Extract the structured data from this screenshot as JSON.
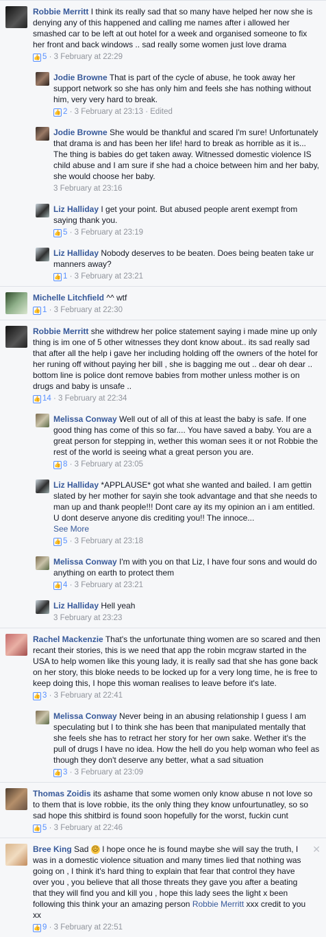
{
  "like_glyph": "👍",
  "comments": [
    {
      "author": "Robbie Merritt",
      "text": "I think its really sad that so many have helped her now she is denying any of this happened and calling me names after i allowed her smashed car to be left at out hotel for a week and organised someone to fix her front and back windows .. sad really some women just love drama",
      "likes": "5",
      "time": "3 February at 22:29"
    },
    {
      "author": "Jodie Browne",
      "text": "That is part of the cycle of abuse, he took away her support network so she has only him and feels she has nothing without him, very very hard to break.",
      "likes": "2",
      "time": "3 February at 23:13",
      "edited": "Edited"
    },
    {
      "author": "Jodie Browne",
      "text": "She would be thankful and scared I'm sure! Unfortunately that drama is and has been her life! hard to break as horrible as it is... The thing is babies do get taken away. Witnessed domestic violence IS child abuse and I am sure if she had a choice between him and her baby, she would choose her baby.",
      "time": "3 February at 23:16"
    },
    {
      "author": "Liz Halliday",
      "text": "I get your point. But abused people arent exempt from saying thank you.",
      "likes": "5",
      "time": "3 February at 23:19"
    },
    {
      "author": "Liz Halliday",
      "text": "Nobody deserves to be beaten. Does being beaten take ur manners away?",
      "likes": "1",
      "time": "3 February at 23:21"
    },
    {
      "author": "Michelle Litchfield",
      "text": "^^ wtf",
      "likes": "1",
      "time": "3 February at 22:30"
    },
    {
      "author": "Robbie Merritt",
      "text": "she withdrew her police statement saying i made mine up only thing is im one of 5 other witnesses they dont know about.. its sad really sad that after all the help i gave her including holding off the owners of the hotel for her runing off without paying her bill , she is bagging me out .. dear oh dear .. bottom line is police dont remove babies from mother unless mother is on drugs and baby is unsafe ..",
      "likes": "14",
      "time": "3 February at 22:34"
    },
    {
      "author": "Melissa Conway",
      "text": "Well out of all of this at least the baby is safe. If one good thing has come of this so far.... You have saved a baby. You are a great person for stepping in, wether this woman sees it or not Robbie the rest of the world is seeing what a great person you are.",
      "likes": "8",
      "time": "3 February at 23:05"
    },
    {
      "author": "Liz Halliday",
      "text": "*APPLAUSE* got what she wanted and bailed. I am gettin slated by her mother for sayin she took advantage and that she needs to man up and thank people!!! Dont care ay its my opinion an i am entitled. U dont deserve anyone dis crediting you!! The innoce...",
      "see_more": "See More",
      "likes": "5",
      "time": "3 February at 23:18"
    },
    {
      "author": "Melissa Conway",
      "text": "I'm with you on that Liz, I have four sons and would do anything on earth to protect them",
      "likes": "4",
      "time": "3 February at 23:21"
    },
    {
      "author": "Liz Halliday",
      "text": "Hell yeah",
      "time": "3 February at 23:23"
    },
    {
      "author": "Rachel Mackenzie",
      "text": "That's the unfortunate thing women are so scared and then recant their stories, this is we need that app the robin mcgraw started in the USA to help women like this young lady, it is really sad that she has gone back on her story, this bloke needs to be locked up for a very long time, he is free to keep doing this, I hope this woman realises to leave before it's late.",
      "likes": "3",
      "time": "3 February at 22:41"
    },
    {
      "author": "Melissa Conway",
      "text": "Never being in an abusing relationship I guess I am speculating but I to think she has been that manipulated mentally that she feels she has to retract her story for her own sake. Wether it's the pull of drugs I have no idea. How the hell do you help woman who feel as though they don't deserve any better, what a sad situation",
      "likes": "3",
      "time": "3 February at 23:09"
    },
    {
      "author": "Thomas Zoidis",
      "text": "its ashame that some women only know abuse n not love so to them that is love robbie, its the only thing they know unfourtunatley, so so sad hope this shitbird is found soon hopefully for the worst, fuckin cunt",
      "likes": "5",
      "time": "3 February at 22:46"
    },
    {
      "author": "Bree King",
      "text_a": "Sad",
      "text_b": "I hope once he is found maybe she will say the truth, I was in a domestic violence situation and many times lied that nothing was going on , I think it's hard thing to explain that fear that control they have over you , you believe that all those threats they gave you after a beating that they will find you and kill you , hope this lady sees the light x been following this think your an amazing person",
      "mention": "Robbie Merritt",
      "text_c": "xxx credit to you xx",
      "likes": "9",
      "time": "3 February at 22:51",
      "close": "✕"
    }
  ]
}
